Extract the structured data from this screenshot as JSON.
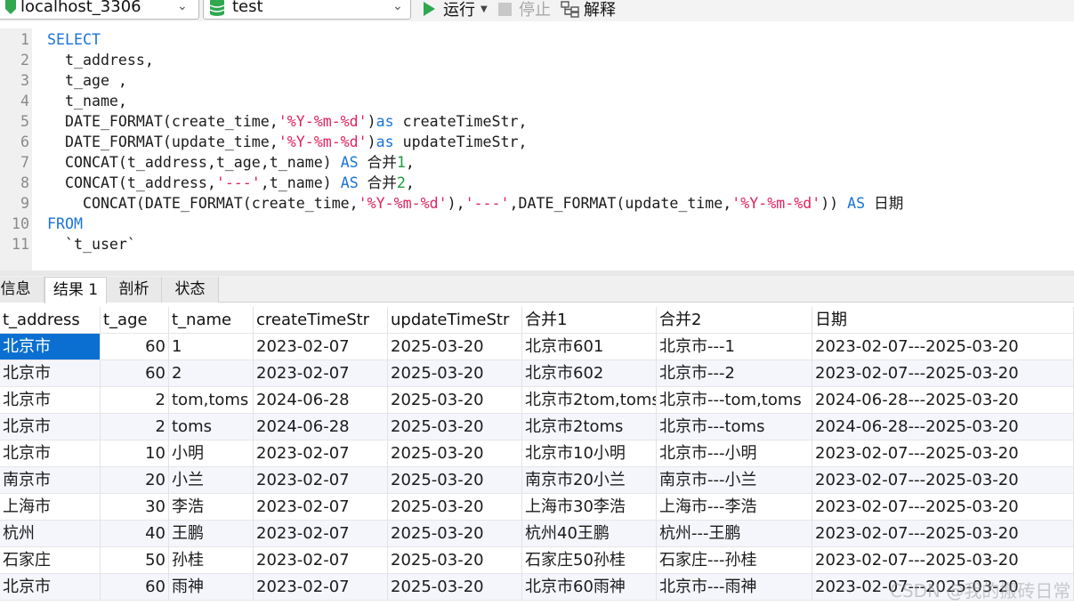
{
  "toolbar": {
    "connection": "localhost_3306",
    "database": "test",
    "run_label": "运行",
    "stop_label": "停止",
    "explain_label": "解释"
  },
  "editor": {
    "lines": [
      {
        "n": "1",
        "segs": [
          {
            "t": "SELECT",
            "c": "#1a74d8"
          }
        ]
      },
      {
        "n": "2",
        "segs": [
          {
            "t": "  t_address,",
            "c": "#1b1b1b"
          }
        ]
      },
      {
        "n": "3",
        "segs": [
          {
            "t": "  t_age ,",
            "c": "#1b1b1b"
          }
        ]
      },
      {
        "n": "4",
        "segs": [
          {
            "t": "  t_name,",
            "c": "#1b1b1b"
          }
        ]
      },
      {
        "n": "5",
        "segs": [
          {
            "t": "  DATE_FORMAT(create_time,",
            "c": "#1b1b1b"
          },
          {
            "t": "'%Y-%m-%d'",
            "c": "#e0245e"
          },
          {
            "t": ")",
            "c": "#1b1b1b"
          },
          {
            "t": "as",
            "c": "#1a74d8"
          },
          {
            "t": " createTimeStr,",
            "c": "#1b1b1b"
          }
        ]
      },
      {
        "n": "6",
        "segs": [
          {
            "t": "  DATE_FORMAT(update_time,",
            "c": "#1b1b1b"
          },
          {
            "t": "'%Y-%m-%d'",
            "c": "#e0245e"
          },
          {
            "t": ")",
            "c": "#1b1b1b"
          },
          {
            "t": "as",
            "c": "#1a74d8"
          },
          {
            "t": " updateTimeStr,",
            "c": "#1b1b1b"
          }
        ]
      },
      {
        "n": "7",
        "segs": [
          {
            "t": "  CONCAT(t_address,t_age,t_name) ",
            "c": "#1b1b1b"
          },
          {
            "t": "AS",
            "c": "#1a74d8"
          },
          {
            "t": " 合并",
            "c": "#1b1b1b"
          },
          {
            "t": "1",
            "c": "#1a9c3a"
          },
          {
            "t": ",",
            "c": "#1b1b1b"
          }
        ]
      },
      {
        "n": "8",
        "segs": [
          {
            "t": "  CONCAT(t_address,",
            "c": "#1b1b1b"
          },
          {
            "t": "'---'",
            "c": "#e0245e"
          },
          {
            "t": ",t_name) ",
            "c": "#1b1b1b"
          },
          {
            "t": "AS",
            "c": "#1a74d8"
          },
          {
            "t": " 合并",
            "c": "#1b1b1b"
          },
          {
            "t": "2",
            "c": "#1a9c3a"
          },
          {
            "t": ",",
            "c": "#1b1b1b"
          }
        ]
      },
      {
        "n": "9",
        "segs": [
          {
            "t": "    CONCAT(DATE_FORMAT(create_time,",
            "c": "#1b1b1b"
          },
          {
            "t": "'%Y-%m-%d'",
            "c": "#e0245e"
          },
          {
            "t": "),",
            "c": "#1b1b1b"
          },
          {
            "t": "'---'",
            "c": "#e0245e"
          },
          {
            "t": ",DATE_FORMAT(update_time,",
            "c": "#1b1b1b"
          },
          {
            "t": "'%Y-%m-%d'",
            "c": "#e0245e"
          },
          {
            "t": ")) ",
            "c": "#1b1b1b"
          },
          {
            "t": "AS",
            "c": "#1a74d8"
          },
          {
            "t": " 日期",
            "c": "#1b1b1b"
          }
        ]
      },
      {
        "n": "10",
        "segs": [
          {
            "t": "FROM",
            "c": "#1a74d8"
          }
        ]
      },
      {
        "n": "11",
        "segs": [
          {
            "t": "  `t_user`",
            "c": "#1b1b1b"
          }
        ]
      }
    ]
  },
  "tabs": [
    "信息",
    "结果 1",
    "剖析",
    "状态"
  ],
  "grid": {
    "columns": [
      "t_address",
      "t_age",
      "t_name",
      "createTimeStr",
      "updateTimeStr",
      "合并1",
      "合并2",
      "日期"
    ],
    "rows": [
      [
        "北京市",
        "60",
        "1",
        "2023-02-07",
        "2025-03-20",
        "北京市601",
        "北京市---1",
        "2023-02-07---2025-03-20"
      ],
      [
        "北京市",
        "60",
        "2",
        "2023-02-07",
        "2025-03-20",
        "北京市602",
        "北京市---2",
        "2023-02-07---2025-03-20"
      ],
      [
        "北京市",
        "2",
        "tom,toms",
        "2024-06-28",
        "2025-03-20",
        "北京市2tom,toms",
        "北京市---tom,toms",
        "2024-06-28---2025-03-20"
      ],
      [
        "北京市",
        "2",
        "toms",
        "2024-06-28",
        "2025-03-20",
        "北京市2toms",
        "北京市---toms",
        "2024-06-28---2025-03-20"
      ],
      [
        "北京市",
        "10",
        "小明",
        "2023-02-07",
        "2025-03-20",
        "北京市10小明",
        "北京市---小明",
        "2023-02-07---2025-03-20"
      ],
      [
        "南京市",
        "20",
        "小兰",
        "2023-02-07",
        "2025-03-20",
        "南京市20小兰",
        "南京市---小兰",
        "2023-02-07---2025-03-20"
      ],
      [
        "上海市",
        "30",
        "李浩",
        "2023-02-07",
        "2025-03-20",
        "上海市30李浩",
        "上海市---李浩",
        "2023-02-07---2025-03-20"
      ],
      [
        "杭州",
        "40",
        "王鹏",
        "2023-02-07",
        "2025-03-20",
        "杭州40王鹏",
        "杭州---王鹏",
        "2023-02-07---2025-03-20"
      ],
      [
        "石家庄",
        "50",
        "孙桂",
        "2023-02-07",
        "2025-03-20",
        "石家庄50孙桂",
        "石家庄---孙桂",
        "2023-02-07---2025-03-20"
      ],
      [
        "北京市",
        "60",
        "雨神",
        "2023-02-07",
        "2025-03-20",
        "北京市60雨神",
        "北京市---雨神",
        "2023-02-07---2025-03-20"
      ]
    ]
  },
  "watermark": "CSDN @我的搬砖日常"
}
